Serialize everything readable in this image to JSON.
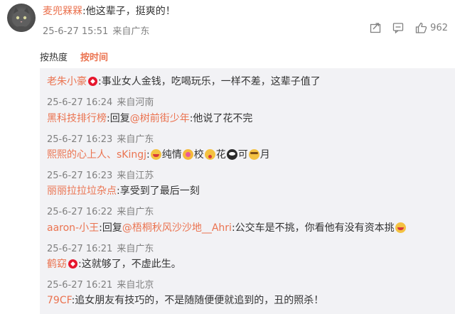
{
  "comment": {
    "username": "麦兜槑槑",
    "text": ":他这辈子，挺爽的！",
    "timestamp": "25-6-27 15:51",
    "source": "来自广东",
    "like_count": "962",
    "icons": [
      "share-icon",
      "comment-icon",
      "like-icon"
    ]
  },
  "sort": {
    "hot_label": "按热度",
    "time_label": "按时间",
    "active": "time"
  },
  "replies": [
    {
      "username": "老朱小豪",
      "badge": "vip-icon",
      "text": ":事业女人金钱，吃喝玩乐，一样不差，这辈子值了",
      "timestamp": "25-6-27 16:24",
      "source": "来自河南"
    },
    {
      "username": "黑科技排行榜",
      "prefix": ":回复",
      "mention": "@树前街少年",
      "text": ":他说了花不完",
      "timestamp": "25-6-27 16:23",
      "source": "来自广东"
    },
    {
      "username": "熙熙的心上人、sKingj",
      "text_parts": [
        ":",
        "纯情",
        "校",
        "花",
        "可",
        "月"
      ],
      "emojis": [
        "lips-emoji",
        "blush-emoji",
        "panda-emoji",
        "kiss-emoji",
        "smirk-emoji"
      ],
      "timestamp": "25-6-27 16:23",
      "source": "来自江苏"
    },
    {
      "username": "丽丽拉拉垃杂点",
      "text": ":享受到了最后一刻",
      "timestamp": "25-6-27 16:22",
      "source": "来自广东"
    },
    {
      "username": "aaron-小王",
      "prefix": ":回复",
      "mention": "@梧桐秋风沙沙地__Ahri",
      "text": ":公交车是不挑，你看他有没有资本挑",
      "emoji": "cat-emoji",
      "timestamp": "25-6-27 16:21",
      "source": "来自广东"
    },
    {
      "username": "鹤窈",
      "badge": "vip-icon",
      "text": ":这就够了，不虚此生。",
      "timestamp": "25-6-27 16:21",
      "source": "来自北京"
    },
    {
      "username": "79CF",
      "text": ":追女朋友有技巧的，不是随随便便就追到的，丑的照杀！"
    }
  ],
  "colors": {
    "accent": "#eb7350",
    "meta": "#808080",
    "panel": "#f2f2f5",
    "vip": "#e6162d"
  }
}
